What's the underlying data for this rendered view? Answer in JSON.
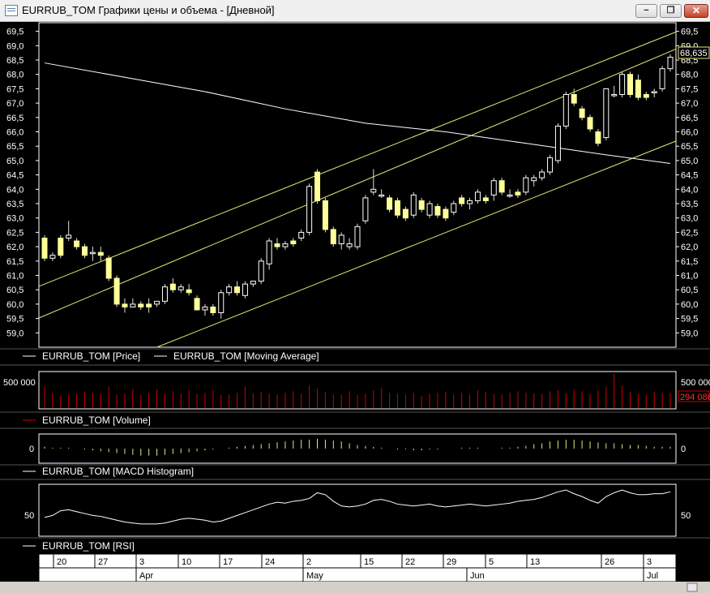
{
  "window": {
    "title": "EURRUB_TOM Графики цены и объема - [Дневной]",
    "buttons": {
      "minimize": "−",
      "restore": "❐",
      "close": "✕"
    }
  },
  "colors": {
    "background": "#000000",
    "candle_up": "#ffffff",
    "candle_down": "#ffff99",
    "channel": "#e6e67a",
    "moving_average": "#ffffff",
    "volume": "#cc0000",
    "grid_border": "#ffffff"
  },
  "price_panel": {
    "y_ticks": [
      "69,5",
      "69,0",
      "68,5",
      "68,0",
      "67,5",
      "67,0",
      "66,5",
      "66,0",
      "65,5",
      "65,0",
      "64,5",
      "64,0",
      "63,5",
      "63,0",
      "62,5",
      "62,0",
      "61,5",
      "61,0",
      "60,5",
      "60,0",
      "59,5",
      "59,0"
    ],
    "last_price_label": "68,635",
    "legend": [
      "EURRUB_TOM [Price]",
      "EURRUB_TOM [Moving Average]"
    ]
  },
  "volume_panel": {
    "y_tick": "500 000",
    "last_value_label": "294 086",
    "legend": "EURRUB_TOM [Volume]"
  },
  "macd_panel": {
    "y_tick": "0",
    "legend": "EURRUB_TOM [MACD Histogram]"
  },
  "rsi_panel": {
    "y_tick": "50",
    "legend": "EURRUB_TOM [RSI]"
  },
  "time_axis": {
    "day_labels": [
      "20",
      "27",
      "3",
      "10",
      "17",
      "24",
      "2",
      "15",
      "22",
      "29",
      "5",
      "13",
      "26",
      "3"
    ],
    "month_labels": [
      "Apr",
      "May",
      "Jun",
      "Jul"
    ]
  },
  "chart_data": {
    "type": "candlestick",
    "title": "EURRUB_TOM Графики цены и объема - [Дневной]",
    "ylim": [
      58.5,
      69.8
    ],
    "y_units": "RUB",
    "series": [
      {
        "name": "EURRUB_TOM [Price]",
        "ohlc": [
          [
            62.3,
            62.4,
            61.5,
            61.6
          ],
          [
            61.6,
            61.8,
            61.5,
            61.7
          ],
          [
            62.3,
            62.4,
            61.6,
            61.7
          ],
          [
            62.3,
            62.9,
            62.2,
            62.4
          ],
          [
            62.2,
            62.3,
            61.9,
            62.0
          ],
          [
            62.0,
            62.1,
            61.6,
            61.7
          ],
          [
            61.8,
            62.0,
            61.5,
            61.8
          ],
          [
            61.8,
            62.0,
            61.5,
            61.7
          ],
          [
            61.6,
            61.7,
            60.8,
            60.9
          ],
          [
            60.9,
            61.0,
            59.9,
            60.0
          ],
          [
            60.0,
            60.2,
            59.7,
            59.9
          ],
          [
            59.9,
            60.2,
            59.9,
            60.0
          ],
          [
            60.0,
            60.1,
            59.8,
            59.9
          ],
          [
            60.0,
            60.2,
            59.7,
            59.9
          ],
          [
            60.0,
            60.1,
            59.9,
            60.1
          ],
          [
            60.1,
            60.7,
            60.0,
            60.6
          ],
          [
            60.7,
            60.9,
            60.4,
            60.5
          ],
          [
            60.5,
            60.7,
            60.4,
            60.6
          ],
          [
            60.5,
            60.7,
            60.3,
            60.4
          ],
          [
            60.2,
            60.3,
            59.8,
            59.8
          ],
          [
            59.8,
            60.0,
            59.6,
            59.9
          ],
          [
            59.9,
            60.0,
            59.6,
            59.7
          ],
          [
            59.7,
            60.5,
            59.5,
            60.4
          ],
          [
            60.4,
            60.7,
            60.3,
            60.6
          ],
          [
            60.6,
            60.8,
            60.3,
            60.4
          ],
          [
            60.3,
            60.8,
            60.2,
            60.7
          ],
          [
            60.7,
            60.8,
            60.6,
            60.8
          ],
          [
            60.8,
            61.6,
            60.7,
            61.5
          ],
          [
            61.4,
            62.3,
            61.2,
            62.2
          ],
          [
            62.1,
            62.3,
            61.9,
            62.0
          ],
          [
            62.0,
            62.2,
            61.9,
            62.1
          ],
          [
            62.2,
            62.3,
            62.0,
            62.1
          ],
          [
            62.3,
            62.6,
            62.2,
            62.5
          ],
          [
            62.5,
            64.2,
            62.4,
            64.1
          ],
          [
            64.6,
            64.7,
            63.5,
            63.6
          ],
          [
            63.6,
            63.7,
            62.5,
            62.6
          ],
          [
            62.6,
            62.7,
            62.0,
            62.1
          ],
          [
            62.1,
            62.5,
            61.9,
            62.4
          ],
          [
            62.0,
            62.3,
            61.9,
            62.1
          ],
          [
            62.0,
            62.8,
            61.9,
            62.7
          ],
          [
            62.9,
            63.8,
            62.8,
            63.7
          ],
          [
            63.9,
            64.7,
            63.8,
            64.0
          ],
          [
            63.8,
            64.0,
            63.7,
            63.8
          ],
          [
            63.7,
            63.8,
            63.2,
            63.3
          ],
          [
            63.6,
            63.7,
            63.0,
            63.1
          ],
          [
            63.3,
            63.4,
            62.9,
            63.0
          ],
          [
            63.1,
            63.9,
            63.0,
            63.8
          ],
          [
            63.6,
            63.7,
            63.2,
            63.3
          ],
          [
            63.1,
            63.6,
            63.0,
            63.5
          ],
          [
            63.4,
            63.5,
            63.0,
            63.1
          ],
          [
            63.3,
            63.4,
            62.9,
            63.0
          ],
          [
            63.2,
            63.6,
            63.1,
            63.5
          ],
          [
            63.7,
            63.8,
            63.4,
            63.5
          ],
          [
            63.5,
            63.7,
            63.3,
            63.6
          ],
          [
            63.6,
            64.0,
            63.5,
            63.9
          ],
          [
            63.7,
            63.8,
            63.5,
            63.6
          ],
          [
            63.8,
            64.4,
            63.6,
            64.3
          ],
          [
            64.3,
            64.4,
            63.8,
            63.9
          ],
          [
            63.8,
            64.0,
            63.7,
            63.8
          ],
          [
            63.9,
            64.0,
            63.7,
            63.8
          ],
          [
            63.9,
            64.5,
            63.8,
            64.4
          ],
          [
            64.3,
            64.5,
            64.1,
            64.4
          ],
          [
            64.4,
            64.7,
            64.3,
            64.6
          ],
          [
            64.6,
            65.2,
            64.5,
            65.1
          ],
          [
            65.0,
            66.3,
            64.9,
            66.2
          ],
          [
            66.2,
            67.4,
            66.1,
            67.3
          ],
          [
            67.3,
            67.5,
            66.9,
            67.0
          ],
          [
            66.8,
            66.9,
            66.4,
            66.5
          ],
          [
            66.5,
            66.6,
            66.0,
            66.1
          ],
          [
            66.0,
            66.1,
            65.5,
            65.6
          ],
          [
            65.8,
            67.5,
            65.7,
            67.5
          ],
          [
            67.3,
            67.6,
            67.2,
            67.3
          ],
          [
            67.3,
            68.1,
            67.2,
            68.0
          ],
          [
            68.0,
            68.1,
            67.2,
            67.3
          ],
          [
            67.8,
            68.0,
            67.1,
            67.2
          ],
          [
            67.3,
            67.4,
            67.1,
            67.2
          ],
          [
            67.4,
            67.5,
            67.2,
            67.4
          ],
          [
            67.5,
            68.3,
            67.4,
            68.2
          ],
          [
            68.2,
            68.7,
            68.1,
            68.6
          ]
        ]
      },
      {
        "name": "EURRUB_TOM [Moving Average]",
        "x_index": [
          0,
          10,
          20,
          30,
          40,
          50,
          60,
          70,
          78
        ],
        "values": [
          68.4,
          67.9,
          67.4,
          66.8,
          66.3,
          66.0,
          65.6,
          65.2,
          64.9
        ]
      },
      {
        "name": "EURRUB_TOM [Volume]",
        "values": [
          420000,
          300000,
          240000,
          260000,
          280000,
          320000,
          300000,
          280000,
          420000,
          260000,
          290000,
          380000,
          260000,
          300000,
          370000,
          280000,
          330000,
          290000,
          350000,
          280000,
          300000,
          350000,
          260000,
          270000,
          300000,
          420000,
          290000,
          320000,
          280000,
          260000,
          300000,
          330000,
          280000,
          440000,
          380000,
          310000,
          260000,
          270000,
          330000,
          260000,
          280000,
          350000,
          400000,
          300000,
          280000,
          260000,
          300000,
          240000,
          280000,
          300000,
          320000,
          270000,
          300000,
          260000,
          350000,
          310000,
          280000,
          270000,
          300000,
          330000,
          300000,
          290000,
          280000,
          330000,
          350000,
          290000,
          360000,
          330000,
          280000,
          340000,
          420000,
          670000,
          440000,
          310000,
          280000,
          260000,
          320000,
          300000,
          294086
        ]
      },
      {
        "name": "EURRUB_TOM [MACD Histogram]",
        "values": [
          0.02,
          0.01,
          0.01,
          0.01,
          0.0,
          -0.01,
          -0.02,
          -0.03,
          -0.04,
          -0.05,
          -0.06,
          -0.07,
          -0.08,
          -0.08,
          -0.08,
          -0.07,
          -0.06,
          -0.05,
          -0.04,
          -0.03,
          -0.02,
          -0.01,
          0.0,
          0.01,
          0.02,
          0.03,
          0.04,
          0.05,
          0.06,
          0.07,
          0.08,
          0.09,
          0.1,
          0.1,
          0.11,
          0.1,
          0.09,
          0.08,
          0.06,
          0.04,
          0.03,
          0.02,
          0.01,
          0.0,
          -0.01,
          -0.01,
          -0.02,
          -0.02,
          -0.01,
          -0.01,
          0.0,
          0.0,
          0.01,
          0.01,
          0.01,
          0.0,
          0.0,
          0.01,
          0.01,
          0.02,
          0.03,
          0.05,
          0.06,
          0.08,
          0.09,
          0.1,
          0.1,
          0.09,
          0.08,
          0.07,
          0.06,
          0.06,
          0.05,
          0.04,
          0.04,
          0.03,
          0.02,
          0.02,
          0.02
        ]
      },
      {
        "name": "EURRUB_TOM [RSI]",
        "values": [
          45,
          47,
          52,
          53,
          51,
          49,
          47,
          46,
          44,
          42,
          40,
          39,
          38,
          38,
          38,
          39,
          41,
          43,
          44,
          43,
          42,
          40,
          41,
          44,
          47,
          50,
          53,
          56,
          59,
          61,
          60,
          62,
          63,
          65,
          71,
          69,
          62,
          57,
          56,
          57,
          59,
          63,
          64,
          62,
          59,
          58,
          57,
          58,
          59,
          57,
          56,
          57,
          58,
          59,
          58,
          57,
          58,
          59,
          60,
          62,
          63,
          64,
          66,
          69,
          72,
          74,
          70,
          67,
          63,
          60,
          67,
          71,
          74,
          71,
          69,
          69,
          70,
          70,
          72
        ]
      }
    ],
    "channel_lines": [
      {
        "p1": [
          0,
          60.7
        ],
        "p2": [
          78,
          69.4
        ]
      },
      {
        "p1": [
          0,
          59.6
        ],
        "p2": [
          78,
          68.8
        ]
      },
      {
        "p1": [
          14,
          58.5
        ],
        "p2": [
          78,
          65.6
        ]
      }
    ]
  }
}
